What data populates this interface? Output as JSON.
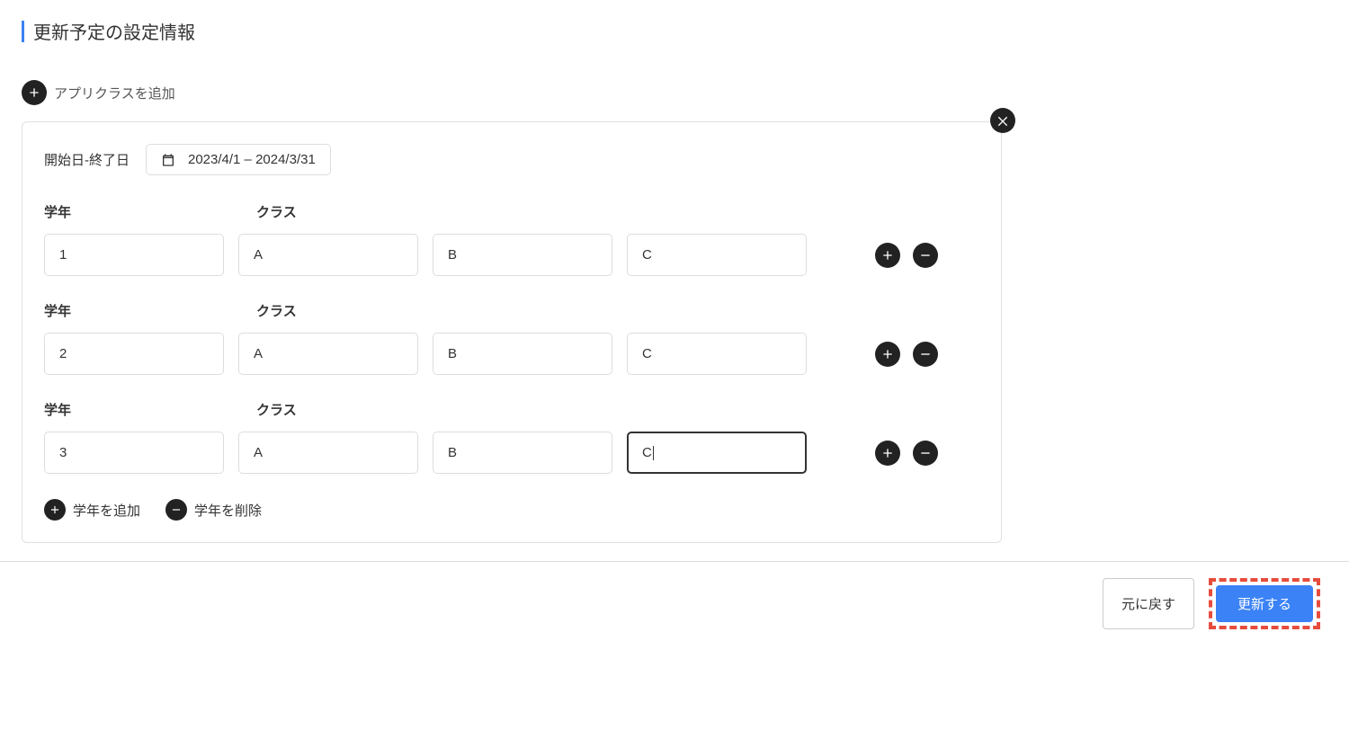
{
  "section_title": "更新予定の設定情報",
  "add_app_class_label": "アプリクラスを追加",
  "date": {
    "label": "開始日-終了日",
    "range": "2023/4/1 – 2024/3/31"
  },
  "labels": {
    "grade": "学年",
    "class": "クラス"
  },
  "rows": [
    {
      "grade": "1",
      "classes": [
        "A",
        "B",
        "C"
      ],
      "focused_index": null
    },
    {
      "grade": "2",
      "classes": [
        "A",
        "B",
        "C"
      ],
      "focused_index": null
    },
    {
      "grade": "3",
      "classes": [
        "A",
        "B",
        "C"
      ],
      "focused_index": 2
    }
  ],
  "bottom_actions": {
    "add_grade": "学年を追加",
    "delete_grade": "学年を削除"
  },
  "footer": {
    "revert": "元に戻す",
    "update": "更新する"
  }
}
